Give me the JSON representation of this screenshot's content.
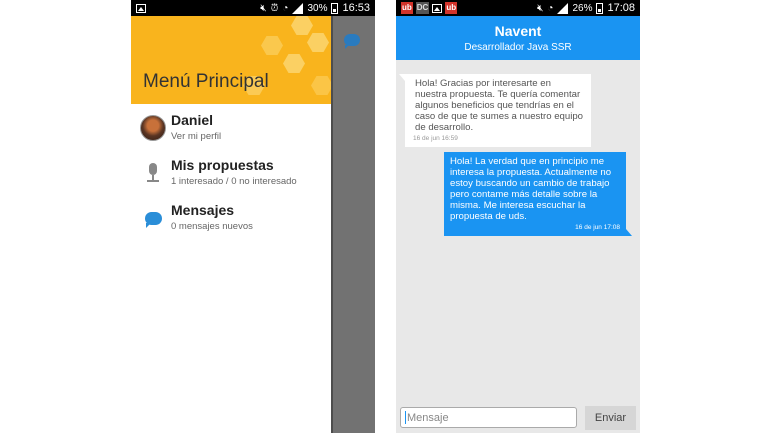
{
  "left_phone": {
    "statusbar": {
      "time": "16:53",
      "battery": "30%"
    },
    "drawer": {
      "title": "Menú Principal",
      "items": [
        {
          "title": "Daniel",
          "subtitle": "Ver mi perfil",
          "icon": "avatar"
        },
        {
          "title": "Mis propuestas",
          "subtitle": "1 interesado / 0 no interesado",
          "icon": "microphone-icon"
        },
        {
          "title": "Mensajes",
          "subtitle": "0 mensajes nuevos",
          "icon": "chat-bubble-icon"
        }
      ]
    },
    "overlay_icon": "chat-bubble-icon"
  },
  "right_phone": {
    "statusbar": {
      "time": "17:08",
      "battery": "26%",
      "notifications": [
        "ub",
        "DC",
        "ub"
      ]
    },
    "header": {
      "title": "Navent",
      "subtitle": "Desarrollador Java  SSR"
    },
    "messages": [
      {
        "direction": "in",
        "text": "Hola! Gracias por interesarte en nuestra propuesta. Te quería comentar algunos beneficios que tendrías en el caso de que te sumes a nuestro equipo de desarrollo.",
        "time": "16 de jun 16:59"
      },
      {
        "direction": "out",
        "text": "Hola! La verdad que en principio me interesa la propuesta. Actualmente no estoy buscando un cambio de trabajo pero contame más detalle sobre la misma. Me interesa escuchar la propuesta de uds.",
        "time": "16 de jun 17:08"
      }
    ],
    "compose": {
      "placeholder": "Mensaje",
      "value": "",
      "send_label": "Enviar"
    }
  },
  "colors": {
    "accent_blue": "#1a94f2",
    "header_yellow": "#f9b41d",
    "overlay_gray": "#727272"
  }
}
